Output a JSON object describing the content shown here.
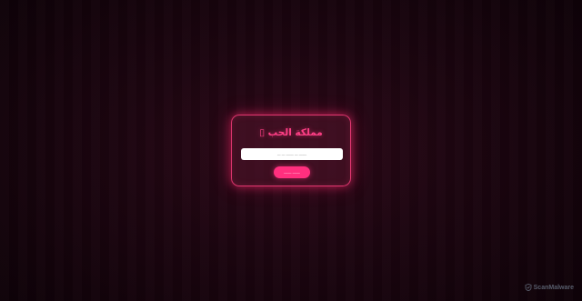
{
  "card": {
    "title": "مملكة الحب ▯",
    "input_placeholder": "ـــــــ ـــ ـــــــ ـــ ـــ",
    "input_value": "",
    "button_label": "ـــــــ ـــــــ"
  },
  "watermark": {
    "text": "ScanMalware",
    "icon": "scanmalware-logo-icon"
  },
  "colors": {
    "accent": "#ff2f7e",
    "title": "#ff3f86",
    "card_border": "#e0366f",
    "background": "#1c0510"
  }
}
